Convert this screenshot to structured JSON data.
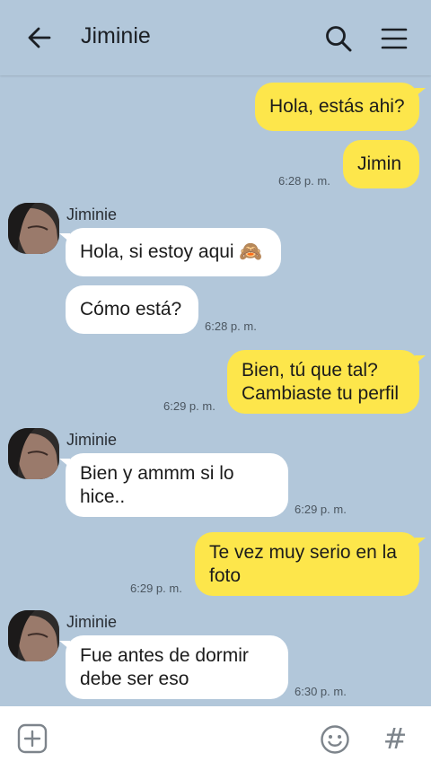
{
  "header": {
    "title": "Jiminie",
    "back_icon": "arrow-left-icon",
    "search_icon": "search-icon",
    "menu_icon": "hamburger-menu-icon"
  },
  "messages": [
    {
      "text": "Hola, estás ahi?"
    },
    {
      "text": "Jimin",
      "time": "6:28 p. m."
    },
    {
      "sender": "Jiminie",
      "text": "Hola, si estoy aqui 🙈"
    },
    {
      "text": "Cómo está?",
      "time": "6:28 p. m."
    },
    {
      "line1": "Bien, tú que tal?",
      "line2": "Cambiaste tu perfil",
      "time": "6:29 p. m."
    },
    {
      "sender": "Jiminie",
      "line1": "Bien y ammm si lo",
      "line2": "hice..",
      "time": "6:29 p. m."
    },
    {
      "line1": "Te vez muy serio en la",
      "line2": "foto",
      "time": "6:29 p. m."
    },
    {
      "sender": "Jiminie",
      "line1": "Fue antes de dormir",
      "line2": "debe ser eso",
      "time": "6:30 p. m."
    }
  ],
  "composer": {
    "add_icon": "plus-square-icon",
    "emoji_icon": "smiley-icon",
    "hash_label": "#"
  },
  "colors": {
    "background": "#b2c7da",
    "outgoing_bubble": "#fde64b",
    "incoming_bubble": "#ffffff"
  }
}
